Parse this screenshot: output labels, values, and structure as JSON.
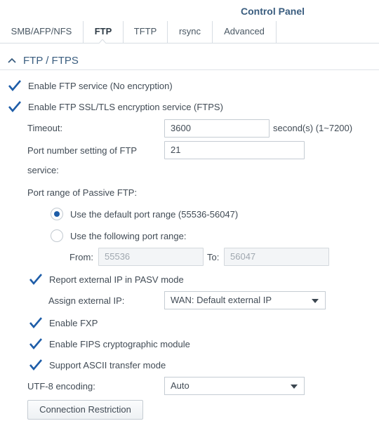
{
  "window": {
    "title": "Control Panel"
  },
  "tabs": [
    {
      "label": "SMB/AFP/NFS"
    },
    {
      "label": "FTP"
    },
    {
      "label": "TFTP"
    },
    {
      "label": "rsync"
    },
    {
      "label": "Advanced"
    }
  ],
  "section": {
    "title": "FTP / FTPS"
  },
  "options": {
    "enable_ftp": {
      "label": "Enable FTP service (No encryption)",
      "checked": true
    },
    "enable_ftps": {
      "label": "Enable FTP SSL/TLS encryption service (FTPS)",
      "checked": true
    }
  },
  "timeout": {
    "label": "Timeout:",
    "value": "3600",
    "suffix": "second(s) (1~7200)"
  },
  "port": {
    "label_line1": "Port number setting of FTP",
    "label_line2": "service:",
    "value": "21"
  },
  "passive": {
    "label": "Port range of Passive FTP:",
    "default_range": {
      "label": "Use the default port range (55536-56047)",
      "checked": true
    },
    "custom_range": {
      "label": "Use the following port range:",
      "checked": false
    },
    "from_label": "From:",
    "from_value": "55536",
    "to_label": "To:",
    "to_value": "56047"
  },
  "pasv": {
    "report_external_ip": {
      "label": "Report external IP in PASV mode",
      "checked": true
    },
    "assign_label": "Assign external IP:",
    "assign_value": "WAN: Default external IP"
  },
  "more_options": {
    "fxp": {
      "label": "Enable FXP",
      "checked": true
    },
    "fips": {
      "label": "Enable FIPS cryptographic module",
      "checked": true
    },
    "ascii": {
      "label": "Support ASCII transfer mode",
      "checked": true
    }
  },
  "utf8": {
    "label": "UTF-8 encoding:",
    "value": "Auto"
  },
  "buttons": {
    "connection_restriction": "Connection Restriction"
  },
  "colors": {
    "accent": "#1e5da8",
    "title": "#3a5d7f",
    "text": "#414b55"
  }
}
